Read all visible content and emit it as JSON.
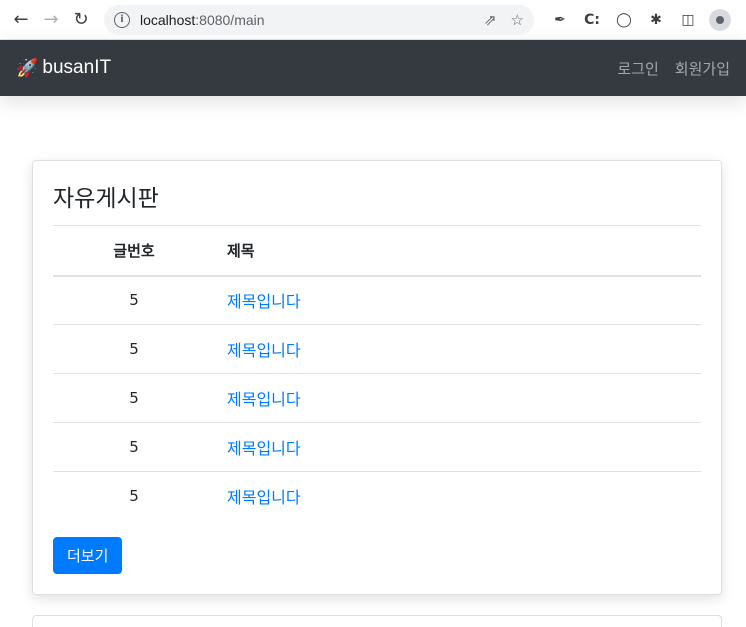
{
  "browser": {
    "url_host": "localhost",
    "url_rest": ":8080/main",
    "icons": [
      "back-icon",
      "forward-icon",
      "reload-icon",
      "info-icon",
      "share-icon",
      "bookmark-star-icon",
      "eyedropper-icon",
      "extension-c-icon",
      "extension-code-icon",
      "puzzle-icon",
      "sidepanel-icon",
      "profile-icon"
    ]
  },
  "navbar": {
    "brand_icon": "🚀",
    "brand": "busanIT",
    "links": [
      "로그인",
      "회원가입"
    ]
  },
  "board": {
    "title": "자유게시판",
    "headers": [
      "글번호",
      "제목"
    ],
    "rows": [
      {
        "num": "5",
        "title": "제목입니다"
      },
      {
        "num": "5",
        "title": "제목입니다"
      },
      {
        "num": "5",
        "title": "제목입니다"
      },
      {
        "num": "5",
        "title": "제목입니다"
      },
      {
        "num": "5",
        "title": "제목입니다"
      }
    ],
    "more_label": "더보기"
  },
  "colors": {
    "navbar_bg": "#343a40",
    "link": "#007bff",
    "button": "#007bff"
  }
}
